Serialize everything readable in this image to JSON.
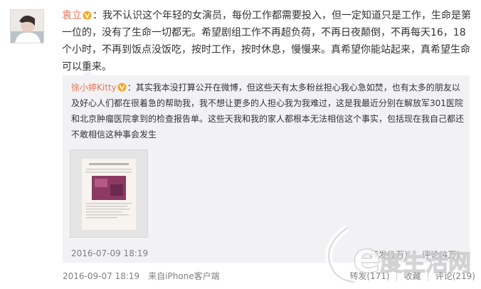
{
  "post": {
    "author": "袁立",
    "colon": "：",
    "text": "我不认识这个年轻的女演员，每份工作都需要投入，但一定知道只是工作，生命是第一位的，没有了生命一切都无。希望剧组工作不再超负荷，不再日夜颠倒，不再每天16，18个小时，不再到饭点没饭吃，按时工作，按时休息，慢慢来。真希望你能站起来，真希望生命可以重来。",
    "time": "2016-09-07 18:19",
    "source": "来自iPhone客户端",
    "actions": {
      "repost": "转发(171)",
      "favorite": "收藏",
      "comment": "评论(219)"
    }
  },
  "quoted": {
    "author": "徐小婷Kitty",
    "colon": "：",
    "text": "其实我本没打算公开在微博，但这些天有太多粉丝担心我心急如焚，也有太多的朋友以及好心人们都在很着急的帮助我，我不想让更多的人担心我为我难过，这是我最近分别在解放军301医院和北京肿瘤医院拿到的检查报告单。这些天我和我的家人都根本无法相信这个事实，包括现在我自己都还不敢相信这种事会发生",
    "time": "2016-07-09 18:19",
    "actions": {
      "repost": "转发(1万)",
      "comment": "评论(4万)"
    }
  },
  "watermark": "e度生活网",
  "colors": {
    "link": "#eb7350",
    "text": "#333333",
    "meta": "#808080",
    "quote_bg": "#f2f2f5",
    "vip_badge": "#f5a623"
  },
  "icons": [
    "avatar",
    "vip-badge-icon",
    "document-thumbnail",
    "watermark-logo"
  ]
}
